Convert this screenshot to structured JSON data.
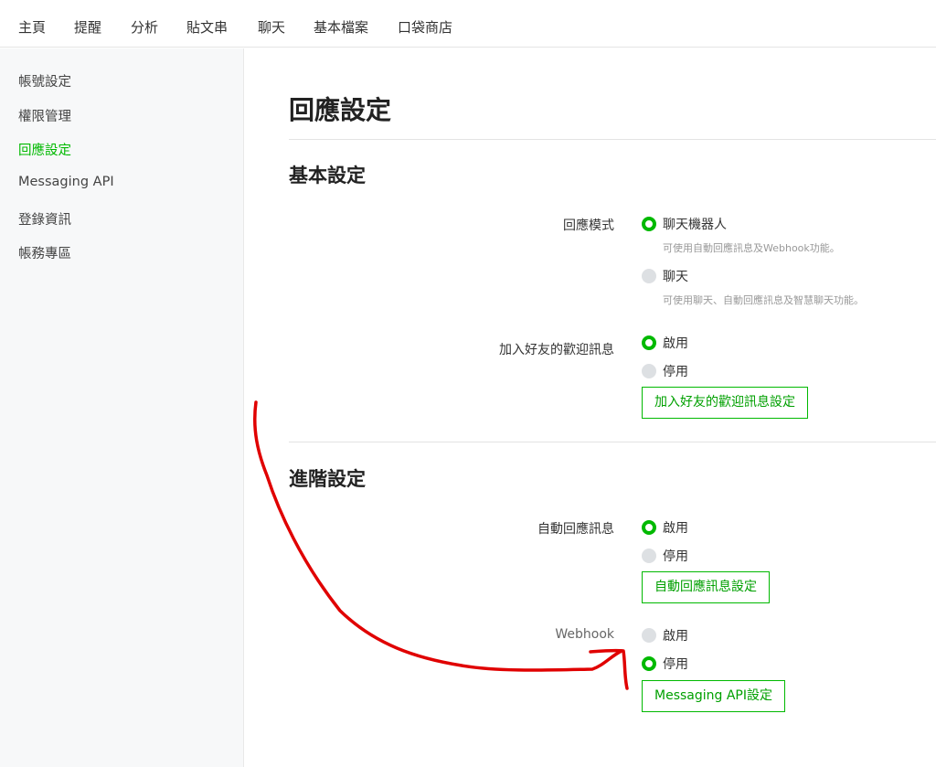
{
  "topnav": {
    "items": [
      "主頁",
      "提醒",
      "分析",
      "貼文串",
      "聊天",
      "基本檔案",
      "口袋商店"
    ]
  },
  "sidebar": {
    "items": [
      {
        "label": "帳號設定"
      },
      {
        "label": "權限管理"
      },
      {
        "label": "回應設定",
        "active": true
      },
      {
        "label": "Messaging API"
      },
      {
        "label": "登錄資訊"
      },
      {
        "label": "帳務專區"
      }
    ]
  },
  "page": {
    "title": "回應設定",
    "basic": {
      "title": "基本設定",
      "response_mode": {
        "label": "回應模式",
        "options": [
          {
            "label": "聊天機器人",
            "hint": "可使用自動回應訊息及Webhook功能。",
            "selected": true
          },
          {
            "label": "聊天",
            "hint": "可使用聊天、自動回應訊息及智慧聊天功能。",
            "selected": false
          }
        ]
      },
      "welcome": {
        "label": "加入好友的歡迎訊息",
        "on_label": "啟用",
        "off_label": "停用",
        "selected": "on",
        "button": "加入好友的歡迎訊息設定"
      }
    },
    "advanced": {
      "title": "進階設定",
      "auto_reply": {
        "label": "自動回應訊息",
        "on_label": "啟用",
        "off_label": "停用",
        "selected": "on",
        "button": "自動回應訊息設定"
      },
      "webhook": {
        "label": "Webhook",
        "on_label": "啟用",
        "off_label": "停用",
        "selected": "off",
        "button": "Messaging API設定"
      }
    }
  },
  "colors": {
    "accent": "#00b900",
    "annotation": "#e00000"
  }
}
